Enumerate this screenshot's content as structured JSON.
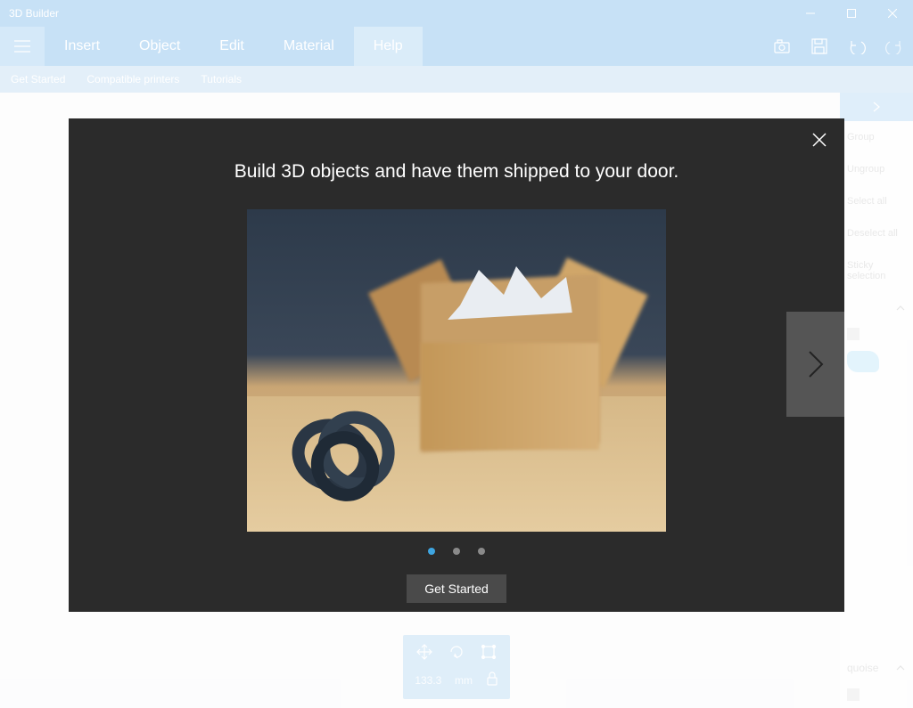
{
  "titlebar": {
    "title": "3D Builder"
  },
  "menu": {
    "items": [
      "Insert",
      "Object",
      "Edit",
      "Material",
      "Help"
    ],
    "active_index": 4
  },
  "submenu": {
    "items": [
      "Get Started",
      "Compatible printers",
      "Tutorials"
    ]
  },
  "right_panel": {
    "items": [
      "Group",
      "Ungroup",
      "Select all",
      "Deselect all",
      "Sticky selection"
    ],
    "section_a_label": "",
    "material_label": "quoise"
  },
  "bottom_toolbar": {
    "value": "133.3",
    "unit": "mm"
  },
  "modal": {
    "title": "Build 3D objects and have them shipped to your door.",
    "pager_count": 3,
    "pager_active": 0,
    "cta_label": "Get Started"
  }
}
